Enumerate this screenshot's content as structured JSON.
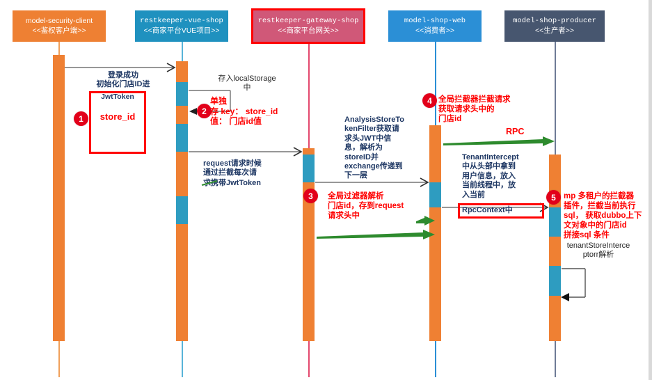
{
  "diagram": {
    "type": "sequence-diagram",
    "title": "",
    "colors": {
      "participant_1": "#ee8033",
      "participant_2": "#1f91bf",
      "participant_3": "#d05878",
      "participant_4": "#2b8fd6",
      "participant_5": "#47566f",
      "activation_orange": "#ef8033",
      "activation_blue": "#2e9cc0",
      "highlight_red": "#ff0000",
      "badge_red": "#e2001a",
      "rpc_green": "#2e8b2e",
      "note_blue": "#1f3864",
      "note_black": "#262626"
    }
  },
  "participants": [
    {
      "name": "model-security-client",
      "stereotype": "<<鉴权客户端>>",
      "color": "#ee8033",
      "highlighted": false
    },
    {
      "name": "restkeeper-vue-shop",
      "stereotype": "<<商家平台VUE项目>>",
      "color": "#1f91bf",
      "highlighted": false
    },
    {
      "name": "restkeeper-gateway-shop",
      "stereotype": "<<商家平台网关>>",
      "color": "#d05878",
      "highlighted": true
    },
    {
      "name": "model-shop-web",
      "stereotype": "<<消费者>>",
      "color": "#2b8fd6",
      "highlighted": false
    },
    {
      "name": "model-shop-producer",
      "stereotype": "<<生产者>>",
      "color": "#47566f",
      "highlighted": false
    }
  ],
  "notes": {
    "login_success": "登录成功\n初始化门店ID进",
    "jwt_token": "JwtToken",
    "store_id": "store_id",
    "local_storage": "存入localStorage\n中",
    "store_key_note": "单独\n存 key： store_id\n值： 门店id值",
    "request_intercept": "request请求时候\n通过拦截每次请",
    "request_intercept_jwt": "求携带JwtToken",
    "analysis_store_token_filter": "AnalysisStoreTo\nkenFilter获取请\n求头JWT中信\n息，解析为\nstoreID并\nexchange传递到\n下一层",
    "global_filter": "全局过滤器解析\n门店id，存到request\n请求头中",
    "global_interceptor": "全局拦截器拦截请求\n获取请求头中的\n门店id",
    "rpc_label": "RPC",
    "tenant_intercept": "TenantIntercept\n中从头部中拿到\n用户信息，放入\n当前线程中，放\n入当前",
    "rpc_context": "RpcContext中",
    "mp_tenant_plugin": "mp 多租户的拦截器\n插件，拦截当前执行\nsql， 获取dubbo上下\n文对象中的门店id\n拼接sql 条件",
    "tenant_store_interceptor": "tenantStoreInterce\nptorr解析"
  },
  "badges": [
    {
      "number": "1"
    },
    {
      "number": "2"
    },
    {
      "number": "3"
    },
    {
      "number": "4"
    },
    {
      "number": "5"
    }
  ]
}
